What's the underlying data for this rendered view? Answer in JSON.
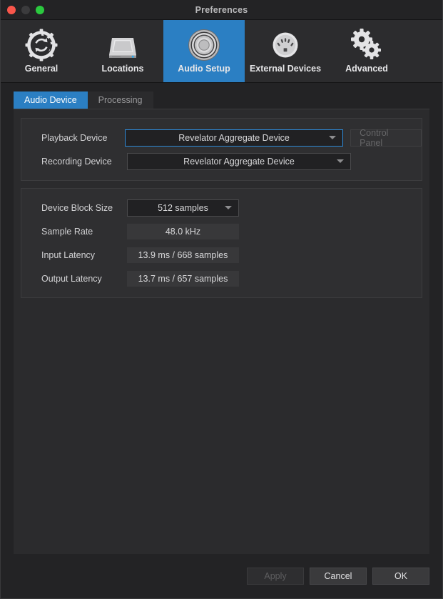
{
  "window": {
    "title": "Preferences",
    "traffic_lights": [
      {
        "name": "close",
        "color": "#f9564b"
      },
      {
        "name": "minimize",
        "color": "#3b3b3d"
      },
      {
        "name": "zoom",
        "color": "#2bc93f"
      }
    ]
  },
  "toolbar": {
    "selected": "Audio Setup",
    "accent": "#2b7fc3",
    "items": [
      {
        "label": "General",
        "icon": "gear-refresh-icon"
      },
      {
        "label": "Locations",
        "icon": "hard-drive-icon"
      },
      {
        "label": "Audio Setup",
        "icon": "speaker-driver-icon"
      },
      {
        "label": "External Devices",
        "icon": "midi-din-connector-icon"
      },
      {
        "label": "Advanced",
        "icon": "double-gear-icon"
      }
    ]
  },
  "tabs": [
    {
      "label": "Audio Device",
      "active": true
    },
    {
      "label": "Processing",
      "active": false
    }
  ],
  "device_group": {
    "playback": {
      "label": "Playback Device",
      "value": "Revelator Aggregate Device",
      "focused": true
    },
    "recording": {
      "label": "Recording Device",
      "value": "Revelator Aggregate Device",
      "focused": false
    },
    "control_panel_button": {
      "label": "Control Panel",
      "disabled": true
    }
  },
  "settings_group": {
    "block_size": {
      "label": "Device Block Size",
      "value": "512 samples"
    },
    "sample_rate": {
      "label": "Sample Rate",
      "value": "48.0 kHz"
    },
    "input_latency": {
      "label": "Input Latency",
      "value": "13.9 ms / 668 samples"
    },
    "output_latency": {
      "label": "Output Latency",
      "value": "13.7 ms / 657 samples"
    }
  },
  "footer": {
    "apply": {
      "label": "Apply",
      "disabled": true
    },
    "cancel": {
      "label": "Cancel",
      "disabled": false
    },
    "ok": {
      "label": "OK",
      "disabled": false
    }
  }
}
